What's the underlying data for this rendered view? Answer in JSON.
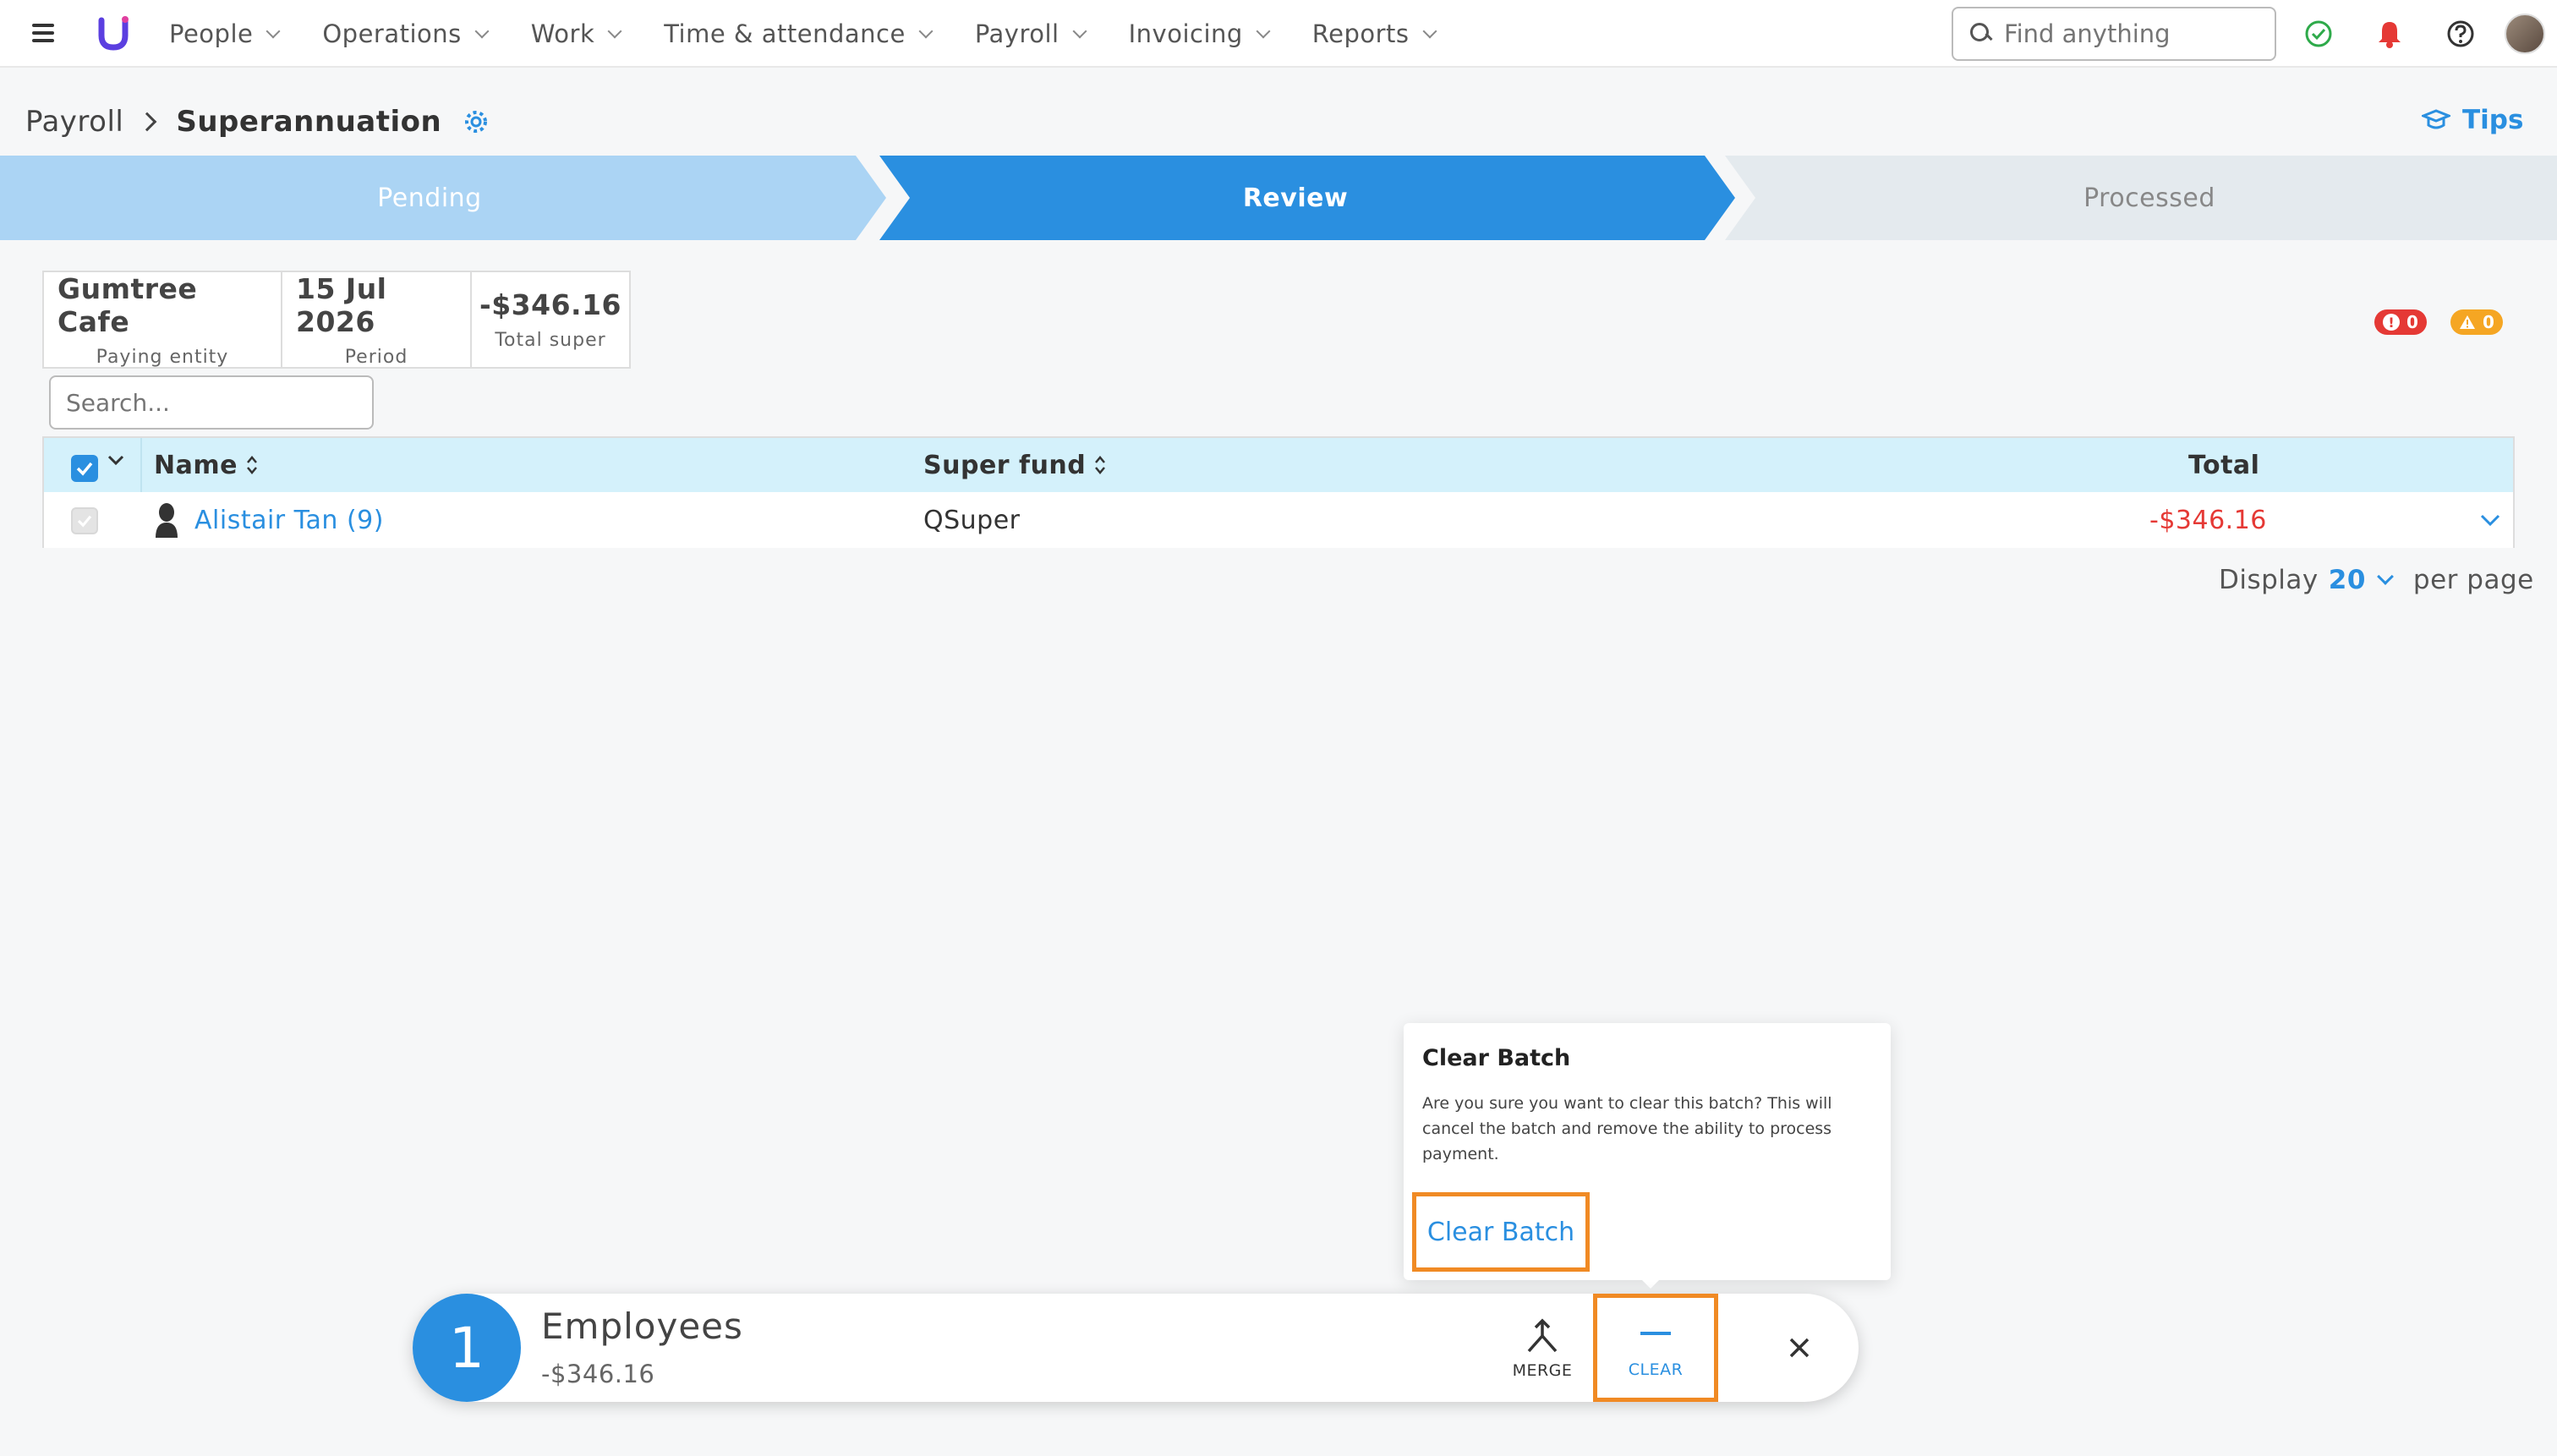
{
  "nav": {
    "items": [
      "People",
      "Operations",
      "Work",
      "Time & attendance",
      "Payroll",
      "Invoicing",
      "Reports"
    ],
    "search_placeholder": "Find anything"
  },
  "breadcrumb": {
    "parent": "Payroll",
    "current": "Superannuation"
  },
  "tips_label": "Tips",
  "stepper": {
    "steps": [
      "Pending",
      "Review",
      "Processed"
    ],
    "active": "Review"
  },
  "summary": [
    {
      "value": "Gumtree Cafe",
      "label": "Paying entity"
    },
    {
      "value": "15 Jul 2026",
      "label": "Period"
    },
    {
      "value": "-$346.16",
      "label": "Total super"
    }
  ],
  "badges": {
    "errors": "0",
    "warnings": "0"
  },
  "table": {
    "search_placeholder": "Search...",
    "columns": {
      "name": "Name",
      "fund": "Super fund",
      "total": "Total"
    },
    "rows": [
      {
        "name": "Alistair Tan (9)",
        "fund": "QSuper",
        "total": "-$346.16"
      }
    ]
  },
  "pagination": {
    "prefix": "Display",
    "value": "20",
    "suffix": "per page"
  },
  "popover": {
    "title": "Clear Batch",
    "body": "Are you sure you want to clear this batch? This will cancel the batch and remove the ability to process payment.",
    "button": "Clear Batch"
  },
  "actionbar": {
    "count": "1",
    "title": "Employees",
    "subtitle": "-$346.16",
    "merge_label": "MERGE",
    "clear_label": "CLEAR"
  },
  "colors": {
    "accent": "#2a8fe0",
    "highlight": "#f08a24",
    "negative": "#e53935",
    "warning": "#f5a623"
  }
}
